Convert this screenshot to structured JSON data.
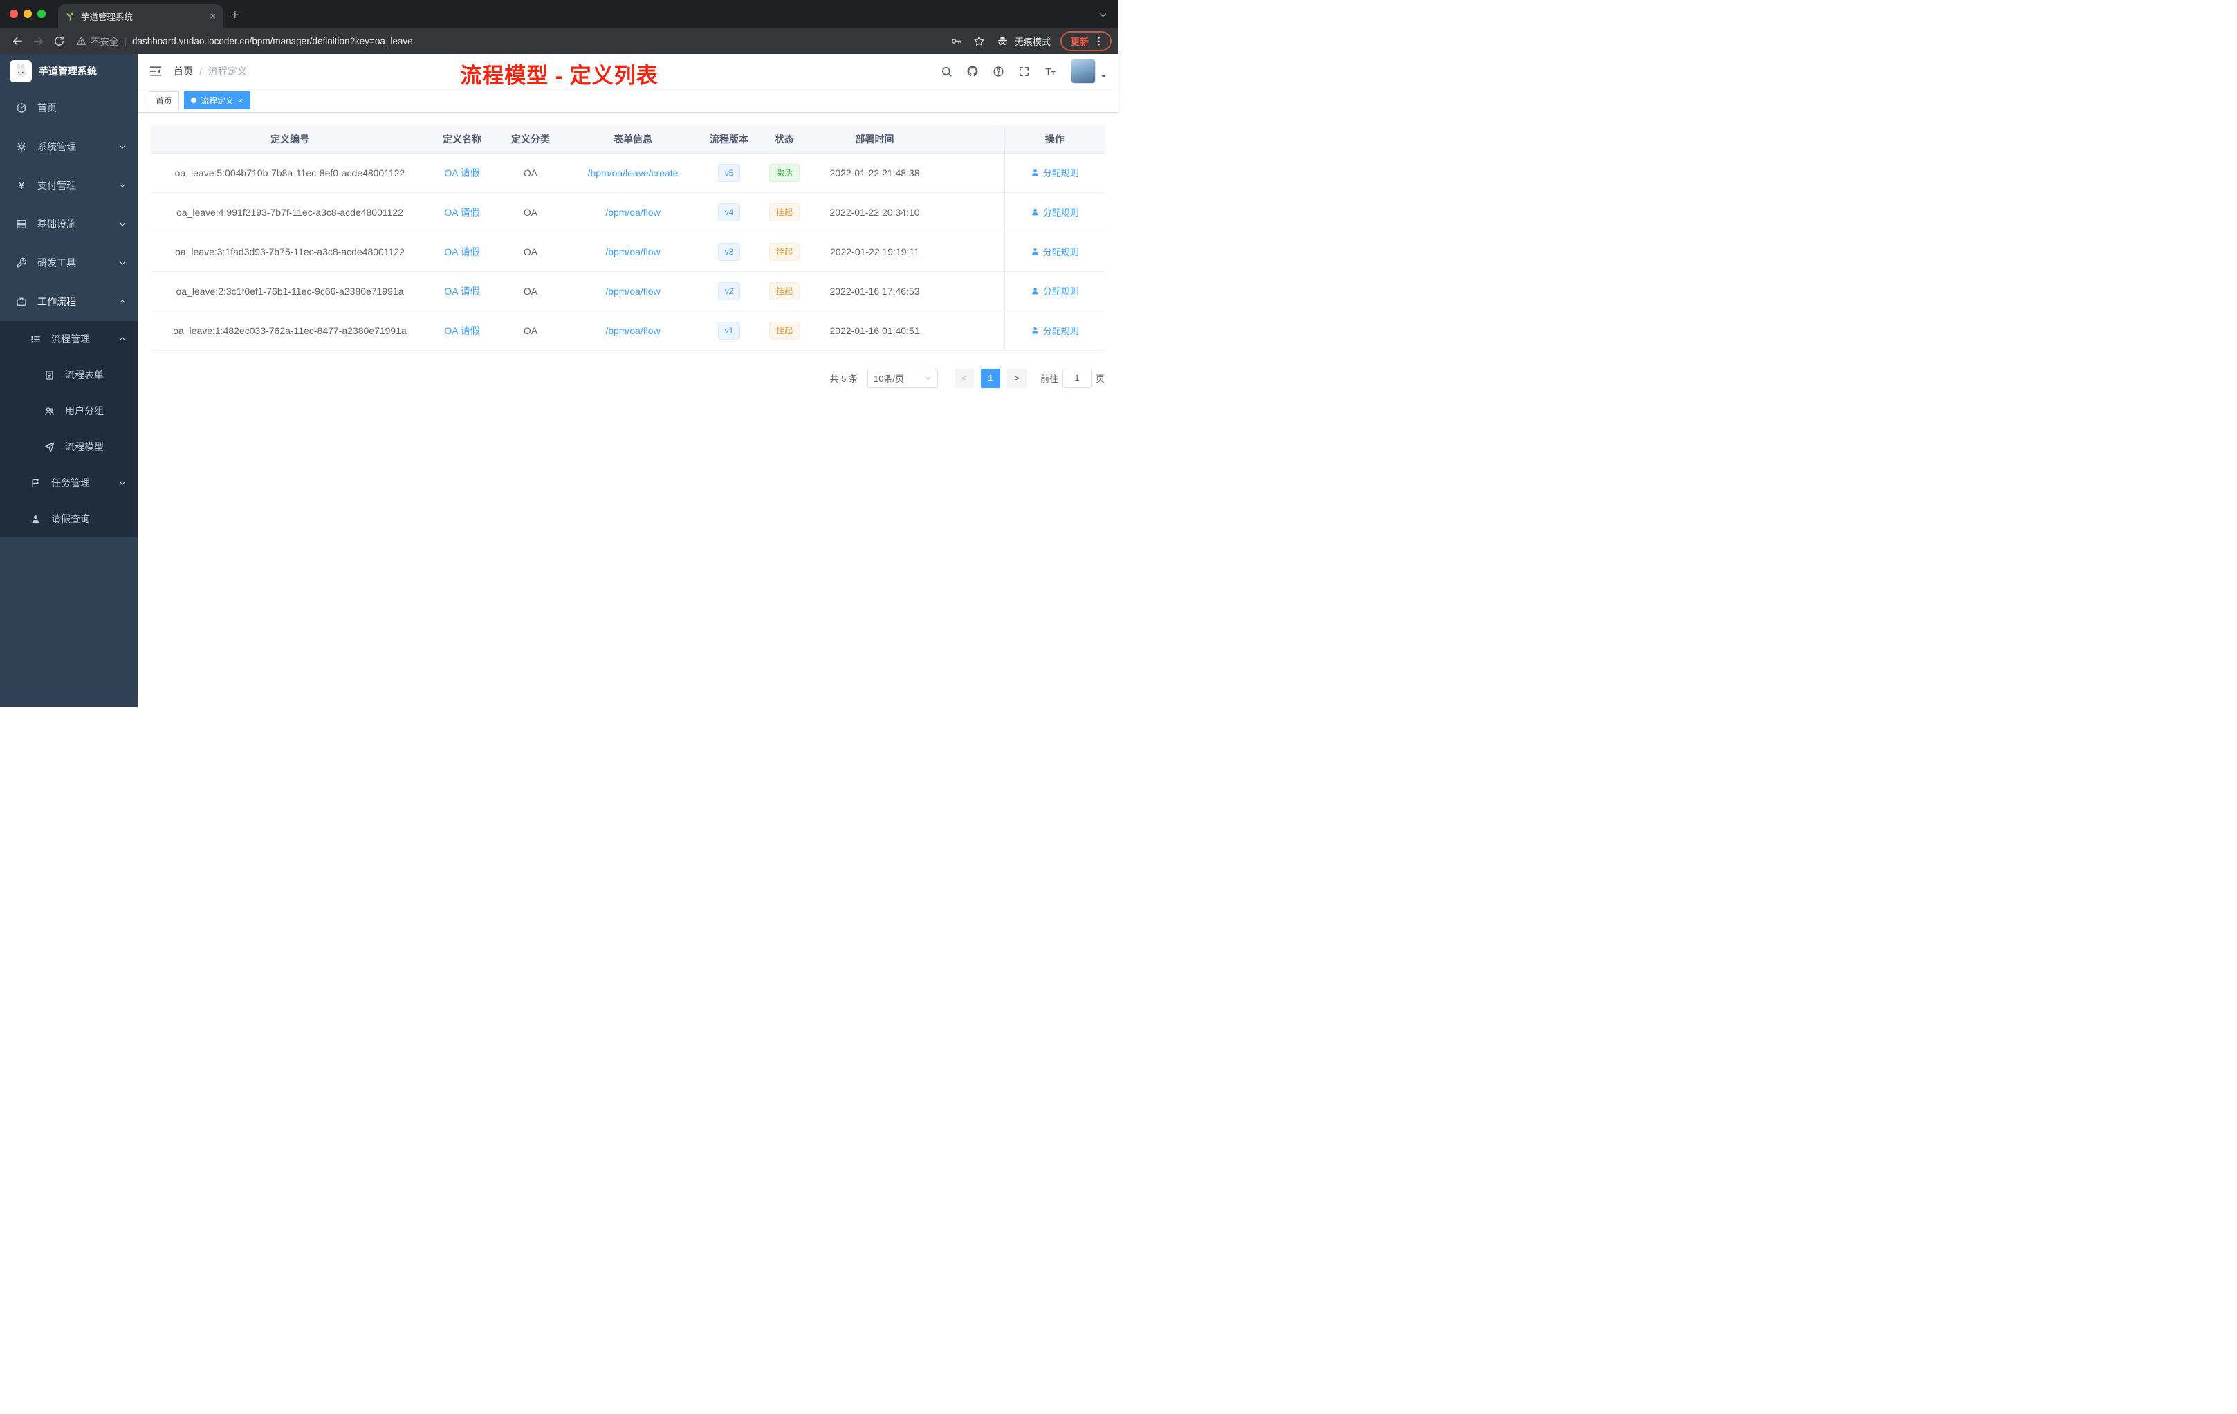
{
  "chrome": {
    "tab_title": "芋道管理系统",
    "security_label": "不安全",
    "url": "dashboard.yudao.iocoder.cn/bpm/manager/definition?key=oa_leave",
    "incognito": "无痕模式",
    "update": "更新"
  },
  "icons": {
    "close": "×",
    "plus": "+",
    "more": "⋮",
    "prev": "<",
    "next": ">"
  },
  "sidebar": {
    "title": "芋道管理系统",
    "menu": [
      {
        "label": "首页",
        "icon": "dashboard-icon"
      },
      {
        "label": "系统管理",
        "icon": "gear-icon"
      },
      {
        "label": "支付管理",
        "icon": "yen-icon"
      },
      {
        "label": "基础设施",
        "icon": "infra-icon"
      },
      {
        "label": "研发工具",
        "icon": "tool-icon"
      },
      {
        "label": "工作流程",
        "icon": "briefcase-icon"
      }
    ],
    "submenu": [
      {
        "label": "流程管理",
        "icon": "list-icon"
      },
      {
        "label": "流程表单",
        "icon": "form-icon"
      },
      {
        "label": "用户分组",
        "icon": "users-icon"
      },
      {
        "label": "流程模型",
        "icon": "paper-plane-icon"
      },
      {
        "label": "任务管理",
        "icon": "flag-icon"
      },
      {
        "label": "请假查询",
        "icon": "person-icon"
      }
    ]
  },
  "navbar": {
    "breadcrumb": [
      "首页",
      "流程定义"
    ],
    "breadcrumb_separator": "/",
    "annotation": "流程模型 - 定义列表"
  },
  "tags": [
    {
      "label": "首页",
      "active": false
    },
    {
      "label": "流程定义",
      "active": true
    }
  ],
  "table": {
    "headers": [
      "定义编号",
      "定义名称",
      "定义分类",
      "表单信息",
      "流程版本",
      "状态",
      "部署时间",
      "操作"
    ],
    "rows": [
      {
        "id": "oa_leave:5:004b710b-7b8a-11ec-8ef0-acde48001122",
        "name": "OA 请假",
        "category": "OA",
        "form": "/bpm/oa/leave/create",
        "version": "v5",
        "status": "激活",
        "time": "2022-01-22 21:48:38",
        "action": "分配规则"
      },
      {
        "id": "oa_leave:4:991f2193-7b7f-11ec-a3c8-acde48001122",
        "name": "OA 请假",
        "category": "OA",
        "form": "/bpm/oa/flow",
        "version": "v4",
        "status": "挂起",
        "time": "2022-01-22 20:34:10",
        "action": "分配规则"
      },
      {
        "id": "oa_leave:3:1fad3d93-7b75-11ec-a3c8-acde48001122",
        "name": "OA 请假",
        "category": "OA",
        "form": "/bpm/oa/flow",
        "version": "v3",
        "status": "挂起",
        "time": "2022-01-22 19:19:11",
        "action": "分配规则"
      },
      {
        "id": "oa_leave:2:3c1f0ef1-76b1-11ec-9c66-a2380e71991a",
        "name": "OA 请假",
        "category": "OA",
        "form": "/bpm/oa/flow",
        "version": "v2",
        "status": "挂起",
        "time": "2022-01-16 17:46:53",
        "action": "分配规则"
      },
      {
        "id": "oa_leave:1:482ec033-762a-11ec-8477-a2380e71991a",
        "name": "OA 请假",
        "category": "OA",
        "form": "/bpm/oa/flow",
        "version": "v1",
        "status": "挂起",
        "time": "2022-01-16 01:40:51",
        "action": "分配规则"
      }
    ]
  },
  "pagination": {
    "total": "共 5 条",
    "page_size": "10条/页",
    "page": "1",
    "goto_label": "前往",
    "goto_value": "1",
    "goto_suffix": "页"
  },
  "colors": {
    "accent": "#409eff",
    "sidebar_bg": "#304156",
    "submenu_bg": "#1f2d3d",
    "success": "#3cb44a",
    "warning": "#e6a23c",
    "annotation_red": "#f5230d",
    "active_tag": "#409eff"
  }
}
